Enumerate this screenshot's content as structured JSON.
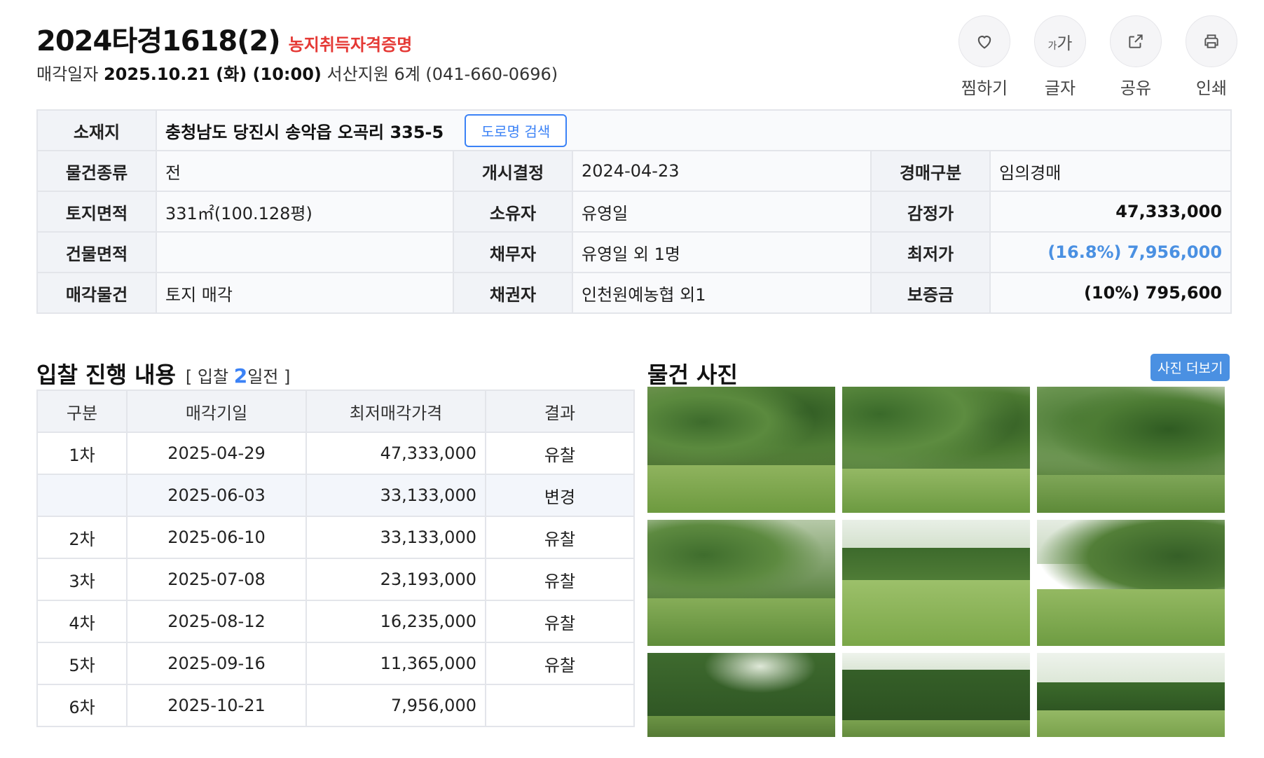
{
  "header": {
    "case_number": "2024타경1618(2)",
    "tag": "농지취득자격증명",
    "sale_date_label": "매각일자",
    "sale_date": "2025.10.21 (화) (10:00)",
    "court": "서산지원 6계 (041-660-0696)"
  },
  "actions": [
    {
      "label": "찜하기",
      "icon": "heart-icon"
    },
    {
      "label": "글자",
      "icon": "font-size-icon",
      "glyph_small": "가",
      "glyph_large": "가"
    },
    {
      "label": "공유",
      "icon": "share-icon"
    },
    {
      "label": "인쇄",
      "icon": "print-icon"
    }
  ],
  "info": {
    "location_label": "소재지",
    "location": "충청남도 당진시 송악읍 오곡리 335-5",
    "road_search_button": "도로명 검색",
    "rows": [
      {
        "h1": "물건종류",
        "v1": "전",
        "h2": "개시결정",
        "v2": "2024-04-23",
        "h3": "경매구분",
        "v3": "임의경매"
      },
      {
        "h1": "토지면적",
        "v1": "331㎡(100.128평)",
        "h2": "소유자",
        "v2": "유영일",
        "h3": "감정가",
        "v3": "47,333,000"
      },
      {
        "h1": "건물면적",
        "v1": "",
        "h2": "채무자",
        "v2": "유영일 외 1명",
        "h3": "최저가",
        "v3": "(16.8%) 7,956,000"
      },
      {
        "h1": "매각물건",
        "v1": "토지 매각",
        "h2": "채권자",
        "v2": "인천원예농협 외1",
        "h3": "보증금",
        "v3": "(10%) 795,600"
      }
    ],
    "highlight_color": "#4a90e2"
  },
  "bids": {
    "title": "입찰 진행 내용",
    "count_prefix": "[ 입찰 ",
    "count": "2",
    "count_suffix": "일전 ]",
    "columns": [
      "구분",
      "매각기일",
      "최저매각가격",
      "결과"
    ],
    "rows": [
      {
        "round": "1차",
        "date": "2025-04-29",
        "price": "47,333,000",
        "result": "유찰"
      },
      {
        "round": "",
        "date": "2025-06-03",
        "price": "33,133,000",
        "result": "변경"
      },
      {
        "round": "2차",
        "date": "2025-06-10",
        "price": "33,133,000",
        "result": "유찰"
      },
      {
        "round": "3차",
        "date": "2025-07-08",
        "price": "23,193,000",
        "result": "유찰"
      },
      {
        "round": "4차",
        "date": "2025-08-12",
        "price": "16,235,000",
        "result": "유찰"
      },
      {
        "round": "5차",
        "date": "2025-09-16",
        "price": "11,365,000",
        "result": "유찰"
      },
      {
        "round": "6차",
        "date": "2025-10-21",
        "price": "7,956,000",
        "result": ""
      }
    ]
  },
  "photos": {
    "title": "물건 사진",
    "more_button": "사진 더보기",
    "count": 9
  },
  "colors": {
    "accent_blue": "#3b82f6",
    "tag_red": "#e53935"
  }
}
